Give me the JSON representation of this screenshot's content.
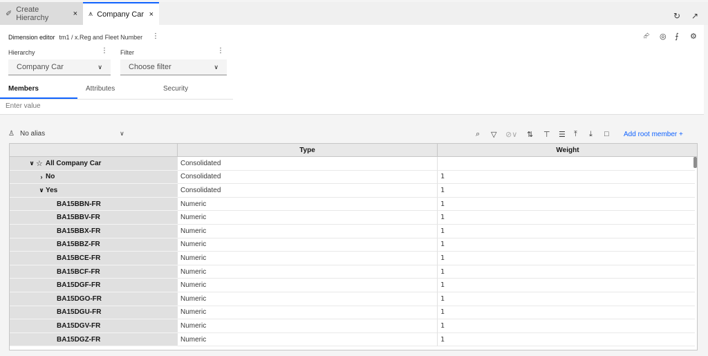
{
  "tabs": [
    {
      "label": "Create Hierarchy",
      "icon": "link-icon"
    },
    {
      "label": "Company Car",
      "icon": "hierarchy-icon"
    }
  ],
  "tab_close": "×",
  "breadcrumb": {
    "title": "Dimension editor",
    "path": "tm1 / x.Reg and Fleet Number"
  },
  "hierarchy": {
    "label": "Hierarchy",
    "value": "Company Car"
  },
  "filter": {
    "label": "Filter",
    "placeholder": "Choose filter"
  },
  "subtabs": [
    "Members",
    "Attributes",
    "Security"
  ],
  "search": {
    "placeholder": "Enter value"
  },
  "alias": {
    "value": "No alias"
  },
  "add_root": "Add root member +",
  "columns": {
    "type": "Type",
    "weight": "Weight"
  },
  "rows": [
    {
      "name": "All Company Car",
      "type": "Consolidated",
      "weight": "",
      "level": 0,
      "caret": "down",
      "star": true
    },
    {
      "name": "No",
      "type": "Consolidated",
      "weight": "1",
      "level": 1,
      "caret": "right",
      "star": false
    },
    {
      "name": "Yes",
      "type": "Consolidated",
      "weight": "1",
      "level": 1,
      "caret": "down",
      "star": false
    },
    {
      "name": "BA15BBN-FR",
      "type": "Numeric",
      "weight": "1",
      "level": 2,
      "caret": "",
      "star": false
    },
    {
      "name": "BA15BBV-FR",
      "type": "Numeric",
      "weight": "1",
      "level": 2,
      "caret": "",
      "star": false
    },
    {
      "name": "BA15BBX-FR",
      "type": "Numeric",
      "weight": "1",
      "level": 2,
      "caret": "",
      "star": false
    },
    {
      "name": "BA15BBZ-FR",
      "type": "Numeric",
      "weight": "1",
      "level": 2,
      "caret": "",
      "star": false
    },
    {
      "name": "BA15BCE-FR",
      "type": "Numeric",
      "weight": "1",
      "level": 2,
      "caret": "",
      "star": false
    },
    {
      "name": "BA15BCF-FR",
      "type": "Numeric",
      "weight": "1",
      "level": 2,
      "caret": "",
      "star": false
    },
    {
      "name": "BA15DGF-FR",
      "type": "Numeric",
      "weight": "1",
      "level": 2,
      "caret": "",
      "star": false
    },
    {
      "name": "BA15DGO-FR",
      "type": "Numeric",
      "weight": "1",
      "level": 2,
      "caret": "",
      "star": false
    },
    {
      "name": "BA15DGU-FR",
      "type": "Numeric",
      "weight": "1",
      "level": 2,
      "caret": "",
      "star": false
    },
    {
      "name": "BA15DGV-FR",
      "type": "Numeric",
      "weight": "1",
      "level": 2,
      "caret": "",
      "star": false
    },
    {
      "name": "BA15DGZ-FR",
      "type": "Numeric",
      "weight": "1",
      "level": 2,
      "caret": "",
      "star": false
    }
  ],
  "colors": {
    "accent": "#0f62fe",
    "name_col_bg": "#e0e0e0"
  }
}
